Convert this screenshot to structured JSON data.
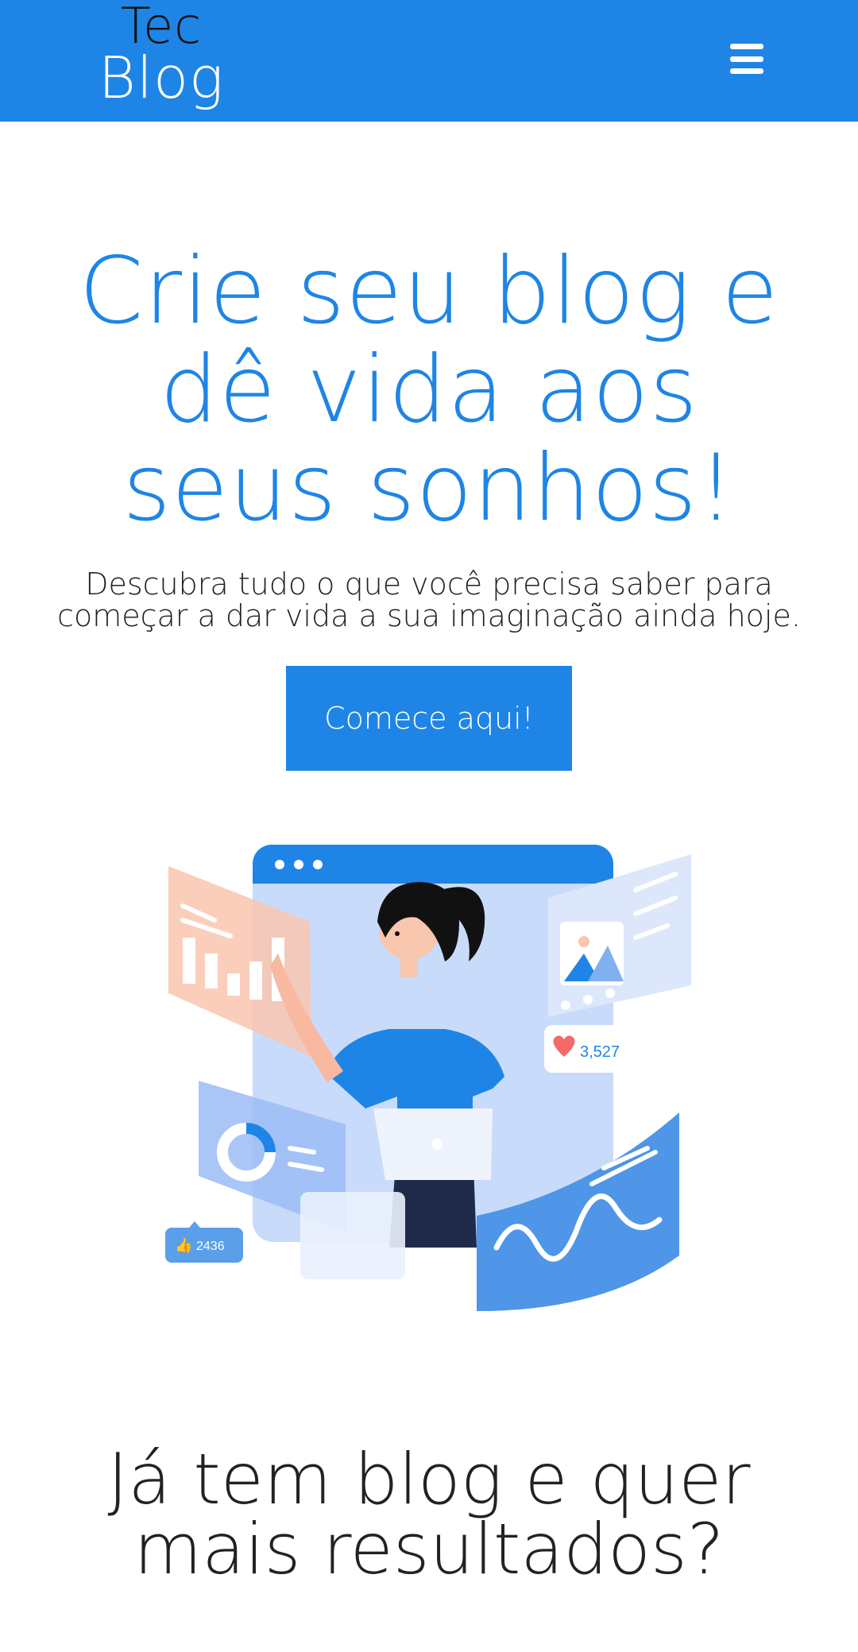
{
  "header": {
    "logo_line1": "Tec",
    "logo_line2": "Blog",
    "menu_icon": "hamburger-menu-icon",
    "background_color": "#1E85E6"
  },
  "hero": {
    "title": "Crie seu blog e dê vida aos seus sonhos!",
    "subtitle": "Descubra tudo o que você precisa saber para começar a dar vida a sua imaginação ainda hoje.",
    "cta_label": "Comece aqui!",
    "accent_color": "#1E85E6"
  },
  "illustration": {
    "likes_count": "2436",
    "hearts_count": "3,527"
  },
  "section": {
    "title": "Já tem blog e quer mais resultados?"
  }
}
